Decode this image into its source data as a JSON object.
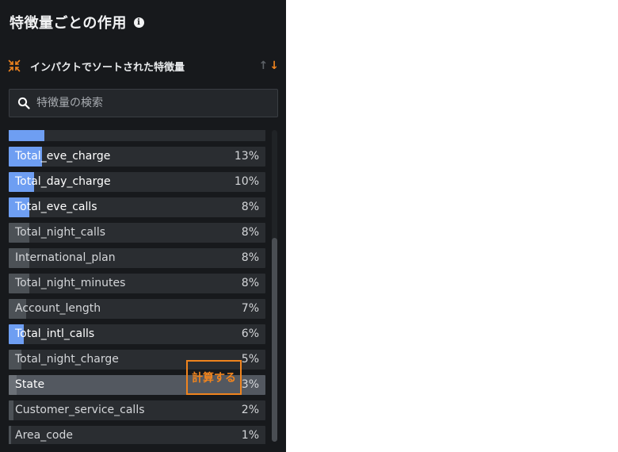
{
  "panel": {
    "title": "特徴量ごとの作用",
    "info_icon": "info-icon"
  },
  "sort": {
    "icon": "collapse-arrows-icon",
    "label": "インパクトでソートされた特徴量",
    "up_icon": "↑",
    "down_icon": "↓"
  },
  "search": {
    "placeholder": "特徴量の検索",
    "value": ""
  },
  "features": [
    {
      "name": "",
      "pct": "",
      "impact": 0.14,
      "color": "blue",
      "bold": false,
      "selected": false,
      "partial": true
    },
    {
      "name": "Total_eve_charge",
      "pct": "13%",
      "impact": 0.13,
      "color": "blue",
      "bold": true,
      "selected": false
    },
    {
      "name": "Total_day_charge",
      "pct": "10%",
      "impact": 0.1,
      "color": "blue",
      "bold": true,
      "selected": false
    },
    {
      "name": "Total_eve_calls",
      "pct": "8%",
      "impact": 0.08,
      "color": "blue",
      "bold": true,
      "selected": false
    },
    {
      "name": "Total_night_calls",
      "pct": "8%",
      "impact": 0.08,
      "color": "grey",
      "bold": false,
      "selected": false
    },
    {
      "name": "International_plan",
      "pct": "8%",
      "impact": 0.08,
      "color": "grey",
      "bold": false,
      "selected": false
    },
    {
      "name": "Total_night_minutes",
      "pct": "8%",
      "impact": 0.08,
      "color": "grey",
      "bold": false,
      "selected": false
    },
    {
      "name": "Account_length",
      "pct": "7%",
      "impact": 0.07,
      "color": "grey",
      "bold": false,
      "selected": false
    },
    {
      "name": "Total_intl_calls",
      "pct": "6%",
      "impact": 0.06,
      "color": "blue",
      "bold": true,
      "selected": false
    },
    {
      "name": "Total_night_charge",
      "pct": "5%",
      "impact": 0.05,
      "color": "grey",
      "bold": false,
      "selected": false
    },
    {
      "name": "State",
      "pct": "3%",
      "impact": 0.03,
      "color": "grey",
      "bold": true,
      "selected": true
    },
    {
      "name": "Customer_service_calls",
      "pct": "2%",
      "impact": 0.02,
      "color": "grey",
      "bold": false,
      "selected": false
    },
    {
      "name": "Area_code",
      "pct": "1%",
      "impact": 0.01,
      "color": "grey",
      "bold": false,
      "selected": false
    }
  ],
  "compute_button": {
    "label": "計算する"
  },
  "colors": {
    "accent": "#f0841e",
    "bar_blue": "#6e9ef2",
    "bar_grey": "#4c5156",
    "panel_bg": "#17191c"
  }
}
